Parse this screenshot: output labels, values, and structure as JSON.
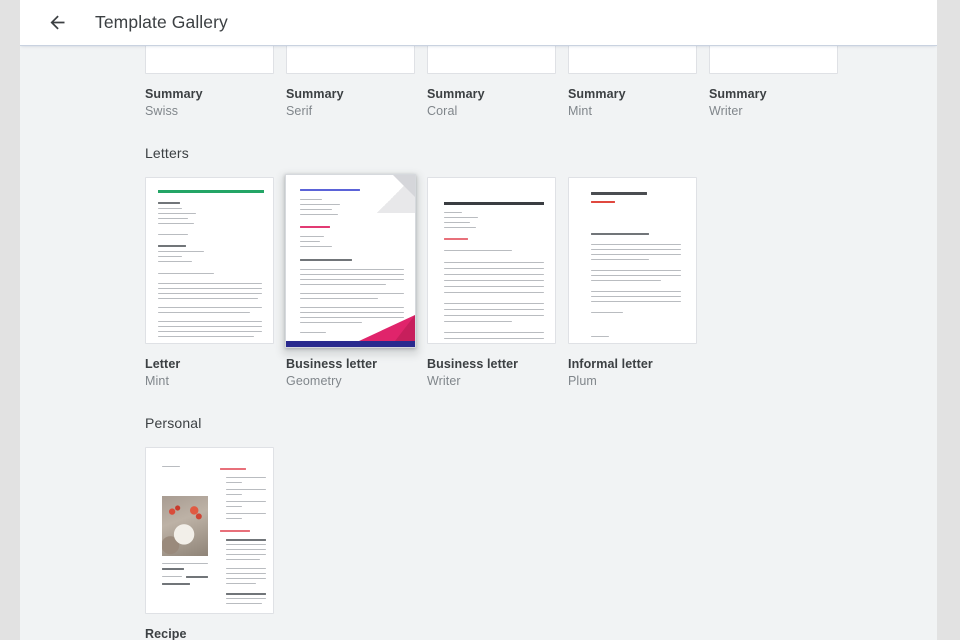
{
  "header": {
    "title": "Template Gallery",
    "back_icon": "arrow-left-icon"
  },
  "sections": [
    {
      "id": "summaries",
      "title": "",
      "templates": [
        {
          "title": "Summary",
          "subtitle": "Swiss",
          "style": "swiss"
        },
        {
          "title": "Summary",
          "subtitle": "Serif",
          "style": "serif"
        },
        {
          "title": "Summary",
          "subtitle": "Coral",
          "style": "coral"
        },
        {
          "title": "Summary",
          "subtitle": "Mint",
          "style": "mint"
        },
        {
          "title": "Summary",
          "subtitle": "Writer",
          "style": "writer"
        }
      ]
    },
    {
      "id": "letters",
      "title": "Letters",
      "templates": [
        {
          "title": "Letter",
          "subtitle": "Mint",
          "style": "letter-mint"
        },
        {
          "title": "Business letter",
          "subtitle": "Geometry",
          "style": "geometry",
          "hovered": true
        },
        {
          "title": "Business letter",
          "subtitle": "Writer",
          "style": "biz-writer"
        },
        {
          "title": "Informal letter",
          "subtitle": "Plum",
          "style": "plum"
        }
      ]
    },
    {
      "id": "personal",
      "title": "Personal",
      "templates": [
        {
          "title": "Recipe",
          "subtitle": "",
          "style": "recipe"
        }
      ]
    }
  ],
  "colors": {
    "page_background": "#f1f3f4",
    "header_background": "#ffffff",
    "title_text": "#3c4043",
    "subtitle_text": "#80868b",
    "card_background": "#ffffff",
    "card_border": "#dfe1e5",
    "mint_accent": "#23a566",
    "geometry_blue": "#5b63d8",
    "geometry_pink": "#e0246b",
    "geometry_navy": "#2a2a8e",
    "coral_accent": "#e8707a",
    "plum_accent": "#e0483f"
  }
}
